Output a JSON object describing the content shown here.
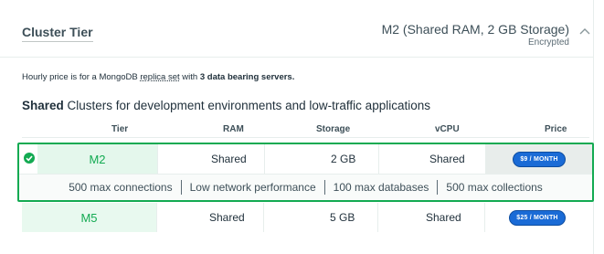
{
  "section": {
    "title": "Cluster Tier",
    "summary": "M2 (Shared RAM, 2 GB Storage)",
    "summary_sub": "Encrypted"
  },
  "hourly_note": {
    "prefix": "Hourly price is for a MongoDB ",
    "link": "replica set",
    "middle": " with ",
    "bold": "3 data bearing servers.",
    "suffix": ""
  },
  "subheading": {
    "bold": "Shared",
    "rest": " Clusters for development environments and low-traffic applications"
  },
  "table": {
    "headers": [
      "Tier",
      "RAM",
      "Storage",
      "vCPU",
      "Price"
    ],
    "rows": [
      {
        "tier": "M2",
        "ram": "Shared",
        "storage": "2 GB",
        "vcpu": "Shared",
        "price": "$9 / MONTH",
        "selected": true
      },
      {
        "tier": "M5",
        "ram": "Shared",
        "storage": "5 GB",
        "vcpu": "Shared",
        "price": "$25 / MONTH",
        "selected": false
      }
    ],
    "selected_details": [
      "500 max connections",
      "Low network performance",
      "100 max databases",
      "500 max collections"
    ]
  },
  "colors": {
    "accent_green": "#13aa52",
    "tier_bg": "#e4f7ec",
    "price_pill": "#1a6bd6"
  }
}
